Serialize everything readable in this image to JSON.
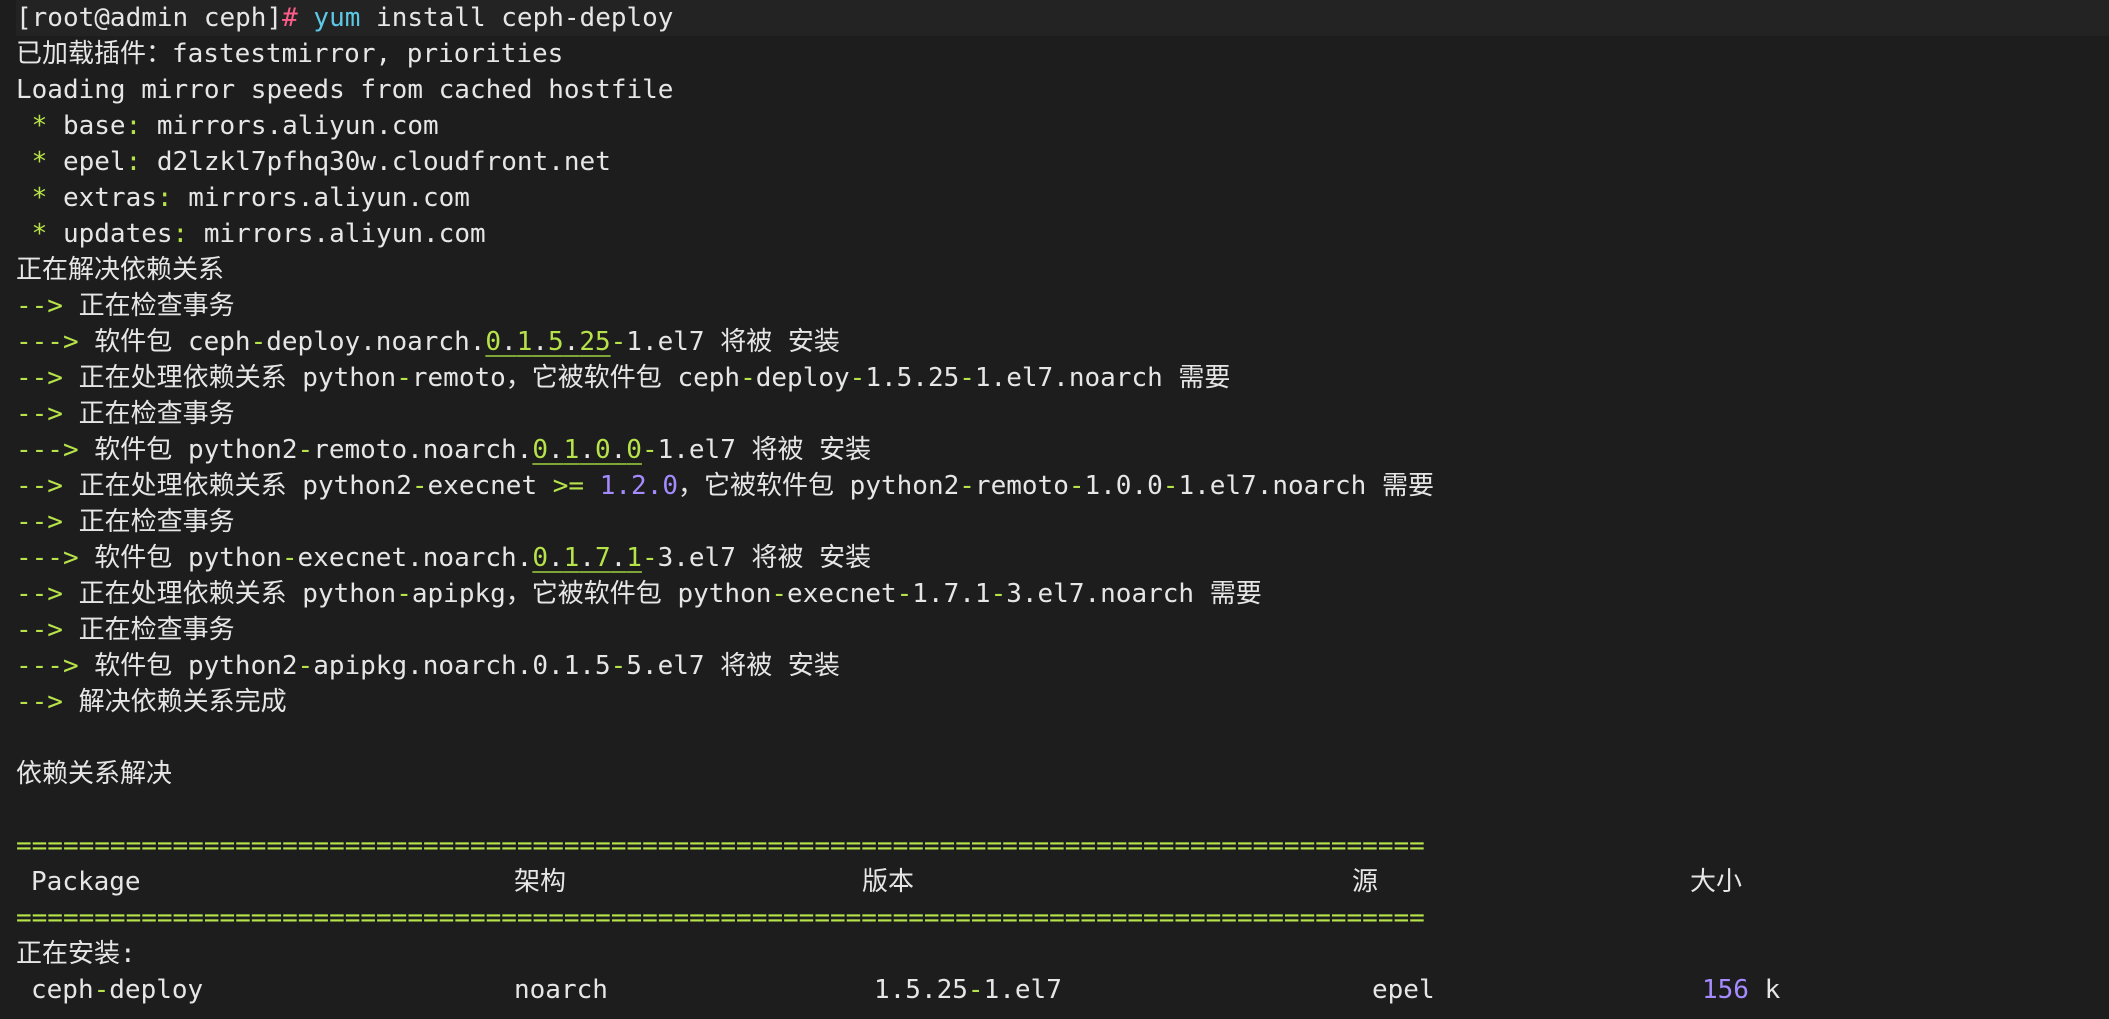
{
  "prompt": {
    "user_host": "[root@admin ceph]",
    "symbol": "#",
    "command": "yum",
    "args": " install ceph-deploy"
  },
  "plugins_line": "已加载插件：fastestmirror, priorities",
  "loading_line": "Loading mirror speeds from cached hostfile",
  "mirrors": [
    {
      "name": "base",
      "url": "mirrors.aliyun.com"
    },
    {
      "name": "epel",
      "url": "d2lzkl7pfhq30w.cloudfront.net"
    },
    {
      "name": "extras",
      "url": "mirrors.aliyun.com"
    },
    {
      "name": "updates",
      "url": "mirrors.aliyun.com"
    }
  ],
  "resolving": "正在解决依赖关系",
  "checking": "正在检查事务",
  "pkg_label": "软件包",
  "install_label": "将被 安装",
  "dep_label": "正在处理依赖关系",
  "required_by": "，它被软件包",
  "needed": "需要",
  "arrow2": "-->",
  "arrow3": "--->",
  "resolve_done": "解决依赖关系完成",
  "resolved": "依赖关系解决",
  "separator": "==========================================================================================",
  "table": {
    "headers": {
      "package": "Package",
      "arch": "架构",
      "version": "版本",
      "repo": "源",
      "size": "大小"
    },
    "installing_label": "正在安装:",
    "row": {
      "package": "ceph-deploy",
      "arch": "noarch",
      "version": "1.5.25-1.el7",
      "repo": "epel",
      "size_num": "156",
      "size_unit": "k"
    }
  }
}
